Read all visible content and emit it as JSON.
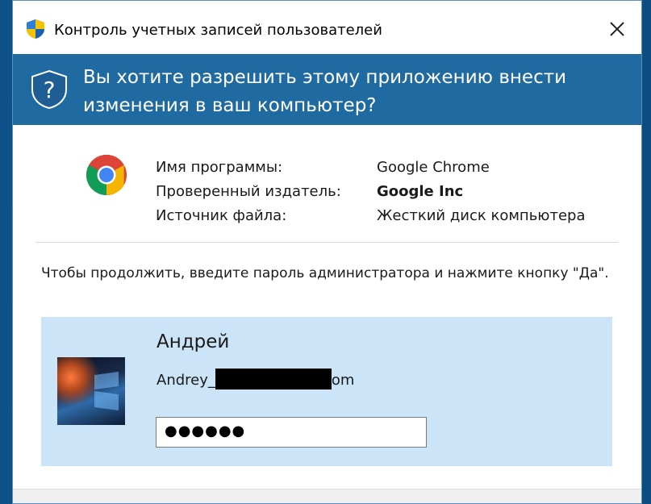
{
  "window": {
    "title": "Контроль учетных записей пользователей"
  },
  "header": {
    "question": "Вы хотите разрешить этому приложению внести изменения в ваш компьютер?"
  },
  "program_info": {
    "labels": [
      "Имя программы:",
      "Проверенный издатель:",
      "Источник файла:"
    ],
    "values": [
      "Google Chrome",
      "Google Inc",
      "Жесткий диск компьютера"
    ]
  },
  "instructions": "Чтобы продолжить, введите пароль администратора и нажмите кнопку \"Да\".",
  "user": {
    "display_name": "Андрей",
    "email_prefix": "Andrey_",
    "email_suffix": "om",
    "password_masked": "●●●●●●"
  },
  "colors": {
    "header_bg": "#1f6aa0",
    "user_tile_bg": "#cce4f7"
  },
  "icons": {
    "title": "uac-shield-icon",
    "header": "question-shield-icon",
    "close": "close-icon",
    "app": "chrome-logo-icon"
  }
}
